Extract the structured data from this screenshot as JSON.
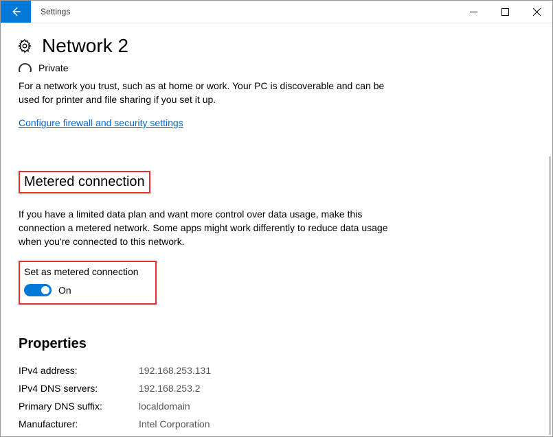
{
  "titlebar": {
    "title": "Settings"
  },
  "page": {
    "title": "Network  2"
  },
  "private": {
    "label": "Private",
    "description": "For a network you trust, such as at home or work. Your PC is discoverable and can be used for printer and file sharing if you set it up."
  },
  "firewall_link": "Configure firewall and security settings",
  "metered": {
    "heading": "Metered connection",
    "description": "If you have a limited data plan and want more control over data usage, make this connection a metered network. Some apps might work differently to reduce data usage when you're connected to this network.",
    "toggle_label": "Set as metered connection",
    "toggle_state": "On"
  },
  "properties": {
    "heading": "Properties",
    "rows": [
      {
        "key": "IPv4 address:",
        "val": "192.168.253.131"
      },
      {
        "key": "IPv4 DNS servers:",
        "val": "192.168.253.2"
      },
      {
        "key": "Primary DNS suffix:",
        "val": "localdomain"
      },
      {
        "key": "Manufacturer:",
        "val": "Intel Corporation"
      }
    ]
  }
}
